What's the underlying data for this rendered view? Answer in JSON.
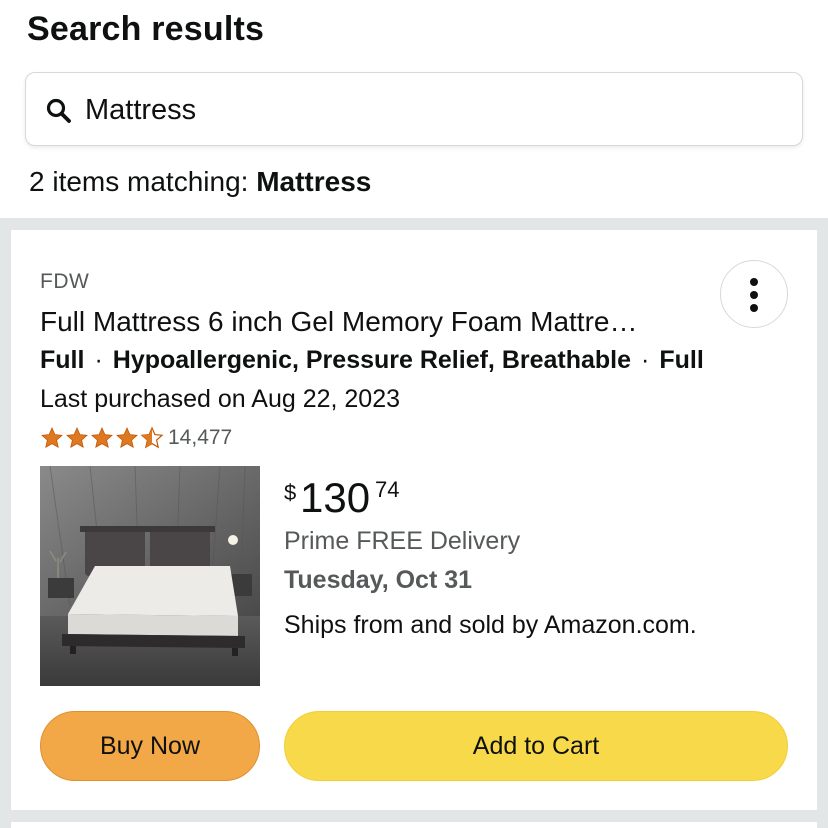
{
  "header": {
    "title": "Search results"
  },
  "search": {
    "query": "Mattress",
    "icon": "search-icon"
  },
  "results_summary": {
    "prefix": "2 items matching: ",
    "term": "Mattress"
  },
  "product": {
    "brand": "FDW",
    "title": "Full Mattress 6 inch Gel Memory Foam Mattre…",
    "attributes": [
      "Full",
      "Hypoallergenic, Pressure Relief, Breathable",
      "Full"
    ],
    "attribute_separator": "·",
    "last_purchased": "Last purchased on Aug 22, 2023",
    "rating": {
      "stars": 4.5,
      "max": 5,
      "count": "14,477",
      "color": "#de7921"
    },
    "price": {
      "symbol": "$",
      "whole": "130",
      "fraction": "74"
    },
    "delivery": "Prime FREE Delivery",
    "delivery_date": "Tuesday, Oct 31",
    "ships": "Ships from and sold by Amazon.com.",
    "buy_now_label": "Buy Now",
    "add_to_cart_label": "Add to Cart",
    "more_options_icon": "more-vertical-icon"
  },
  "colors": {
    "buy_now": "#f3a847",
    "add_to_cart": "#f8d94a",
    "background_band": "#e3e6e6"
  }
}
